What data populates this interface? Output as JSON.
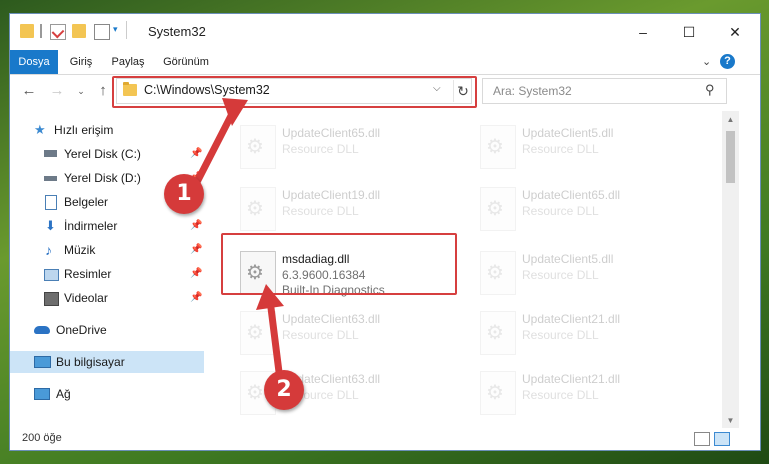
{
  "window": {
    "title": "System32",
    "controls": {
      "minimize": "–",
      "maximize": "☐",
      "close": "✕"
    }
  },
  "ribbon": {
    "tabs": [
      {
        "label": "Dosya",
        "active": true
      },
      {
        "label": "Giriş"
      },
      {
        "label": "Paylaş"
      },
      {
        "label": "Görünüm"
      }
    ],
    "help": "?"
  },
  "navigation": {
    "address": "C:\\Windows\\System32",
    "search_placeholder": "Ara: System32"
  },
  "sidebar": {
    "items": [
      {
        "label": "Hızlı erişim",
        "icon": "star-icon"
      },
      {
        "label": "Yerel Disk (C:)",
        "icon": "drive-icon",
        "pinned": true
      },
      {
        "label": "Yerel Disk (D:)",
        "icon": "drive-icon",
        "pinned": true
      },
      {
        "label": "Belgeler",
        "icon": "documents-icon",
        "pinned": true
      },
      {
        "label": "İndirmeler",
        "icon": "download-icon",
        "pinned": true
      },
      {
        "label": "Müzik",
        "icon": "music-icon",
        "pinned": true
      },
      {
        "label": "Resimler",
        "icon": "pictures-icon",
        "pinned": true
      },
      {
        "label": "Videolar",
        "icon": "videos-icon",
        "pinned": true
      },
      {
        "label": "OneDrive",
        "icon": "cloud-icon"
      },
      {
        "label": "Bu bilgisayar",
        "icon": "computer-icon",
        "selected": true
      },
      {
        "label": "Ağ",
        "icon": "network-icon"
      }
    ]
  },
  "files": [
    {
      "name": "UpdateClient65.dll",
      "type": "Resource DLL"
    },
    {
      "name": "UpdateClient5.dll",
      "type": "Resource DLL"
    },
    {
      "name": "UpdateClient19.dll",
      "type": "Resource DLL"
    },
    {
      "name": "UpdateClient65.dll",
      "type": "Resource DLL"
    },
    {
      "name": "msdadiag.dll",
      "version": "6.3.9600.16384",
      "type": "Built-In Diagnostics"
    },
    {
      "name": "UpdateClient5.dll",
      "type": "Resource DLL"
    },
    {
      "name": "UpdateClient63.dll",
      "type": "Resource DLL"
    },
    {
      "name": "UpdateClient21.dll",
      "type": "Resource DLL"
    },
    {
      "name": "UpdateClient63.dll",
      "type": "Resource DLL"
    },
    {
      "name": "UpdateClient21.dll",
      "type": "Resource DLL"
    }
  ],
  "status": {
    "item_count": "200 öğe"
  },
  "annotations": {
    "step1": "1",
    "step2": "2",
    "accent": "#d53a3a"
  }
}
